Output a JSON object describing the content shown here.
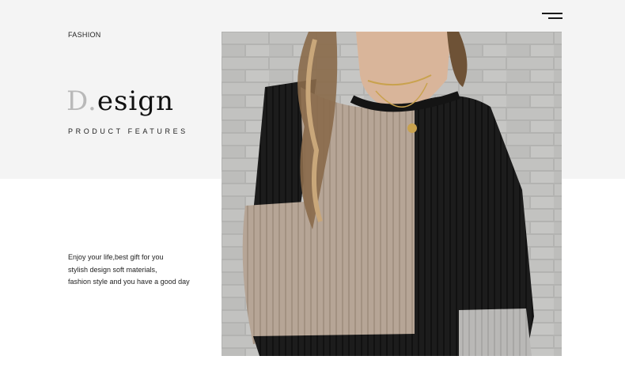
{
  "header": {
    "menu_icon": "hamburger-menu-icon"
  },
  "section": {
    "eyebrow": "FASHION",
    "title_initial": "D.",
    "title_rest": "esign",
    "subtitle": "PRODUCT FEATURES",
    "description": [
      "Enjoy your life,best gift for you",
      "stylish design soft materials,",
      "fashion style and you have a good day"
    ]
  },
  "colors": {
    "band_bg": "#f4f4f4",
    "page_bg": "#ffffff",
    "text": "#222222",
    "initial": "#b9b9b9"
  }
}
